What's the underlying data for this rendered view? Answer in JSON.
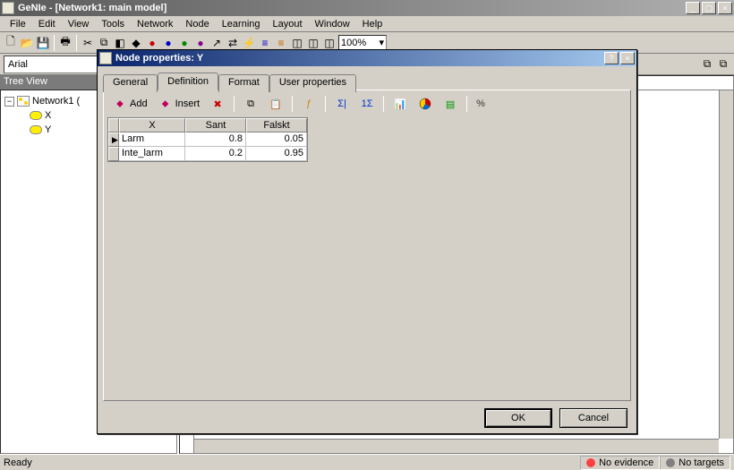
{
  "app": {
    "title": "GeNIe - [Network1: main model]"
  },
  "menu": {
    "file": "File",
    "edit": "Edit",
    "view": "View",
    "tools": "Tools",
    "network": "Network",
    "node": "Node",
    "learning": "Learning",
    "layout": "Layout",
    "window": "Window",
    "help": "Help"
  },
  "toolbar": {
    "zoom": "100%"
  },
  "fontbar": {
    "font": "Arial"
  },
  "tree": {
    "header": "Tree View",
    "root": "Network1 (",
    "nodes": [
      "X",
      "Y"
    ]
  },
  "status": {
    "ready": "Ready",
    "evidence": "No evidence",
    "targets": "No targets"
  },
  "dialog": {
    "title": "Node properties: Y",
    "tabs": {
      "general": "General",
      "definition": "Definition",
      "format": "Format",
      "userprops": "User properties"
    },
    "tb": {
      "add": "Add",
      "insert": "Insert",
      "percent": "%"
    },
    "table": {
      "col0": "X",
      "col1": "Sant",
      "col2": "Falskt",
      "rows": [
        {
          "name": "Larm",
          "v1": "0.8",
          "v2": "0.05"
        },
        {
          "name": "Inte_larm",
          "v1": "0.2",
          "v2": "0.95"
        }
      ]
    },
    "buttons": {
      "ok": "OK",
      "cancel": "Cancel"
    }
  }
}
